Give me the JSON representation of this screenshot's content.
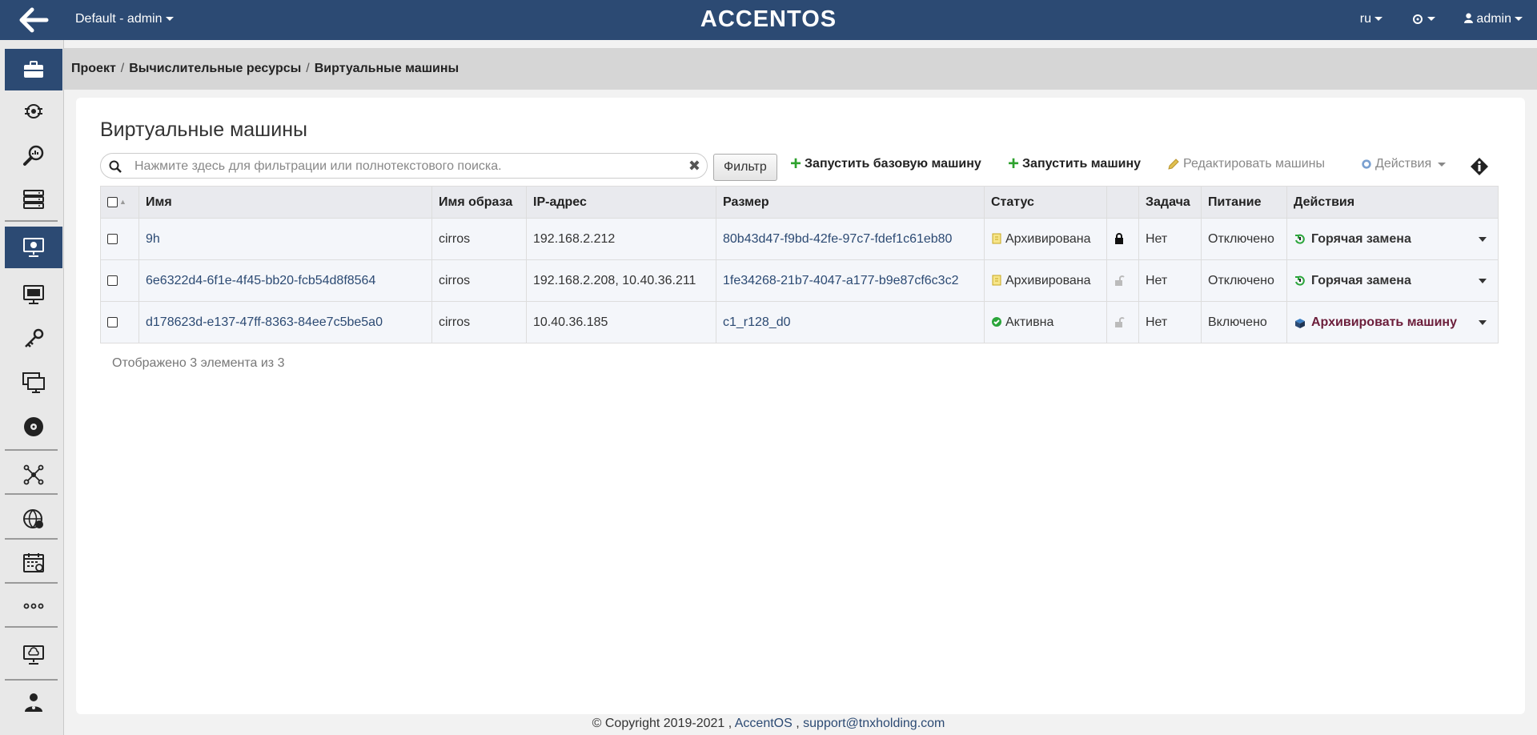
{
  "topbar": {
    "project_selector": "Default - admin",
    "logo": "ACCENTOS",
    "language": "ru",
    "user": "admin"
  },
  "sidebar": {
    "items": [
      {
        "icon": "briefcase-icon",
        "active": false
      },
      {
        "icon": "rocket-icon",
        "active": false
      },
      {
        "icon": "zoom-icon",
        "active": false
      },
      {
        "icon": "server-rack-icon",
        "active": false
      },
      {
        "icon": "monitor-cloud-icon",
        "active": true
      },
      {
        "icon": "monitor-icon",
        "active": false
      },
      {
        "icon": "key-icon",
        "active": false
      },
      {
        "icon": "multi-monitor-icon",
        "active": false
      },
      {
        "icon": "disk-icon",
        "active": false
      },
      {
        "icon": "network-icon",
        "active": false
      },
      {
        "icon": "globe-gear-icon",
        "active": false
      },
      {
        "icon": "calendar-icon",
        "active": false
      },
      {
        "icon": "more-icon",
        "active": false
      },
      {
        "icon": "cloud-monitor-icon",
        "active": false
      },
      {
        "icon": "users-icon",
        "active": false
      }
    ]
  },
  "breadcrumb": {
    "items": [
      "Проект",
      "Вычислительные ресурсы",
      "Виртуальные машины"
    ]
  },
  "page": {
    "title": "Виртуальные машины"
  },
  "search": {
    "placeholder": "Нажмите здесь для фильтрации или полнотекстового поиска."
  },
  "toolbar": {
    "filter": "Фильтр",
    "launch_base": "Запустить базовую машину",
    "launch": "Запустить машину",
    "edit": "Редактировать машины",
    "actions": "Действия"
  },
  "table": {
    "headers": [
      "Имя",
      "Имя образа",
      "IP-адрес",
      "Размер",
      "Статус",
      "",
      "Задача",
      "Питание",
      "Действия"
    ],
    "rows": [
      {
        "name": "9h",
        "image": "cirros",
        "ip": "192.168.2.212",
        "size": "80b43d47-f9bd-42fe-97c7-fdef1c61eb80",
        "status": "Архивирована",
        "status_icon": "archive-status-icon",
        "locked": true,
        "task": "Нет",
        "power": "Отключено",
        "action": "Горячая замена",
        "action_icon": "hot-swap-icon"
      },
      {
        "name": "6e6322d4-6f1e-4f45-bb20-fcb54d8f8564",
        "image": "cirros",
        "ip": "192.168.2.208, 10.40.36.211",
        "size": "1fe34268-21b7-4047-a177-b9e87cf6c3c2",
        "status": "Архивирована",
        "status_icon": "archive-status-icon",
        "locked": false,
        "task": "Нет",
        "power": "Отключено",
        "action": "Горячая замена",
        "action_icon": "hot-swap-icon"
      },
      {
        "name": "d178623d-e137-47ff-8363-84ee7c5be5a0",
        "image": "cirros",
        "ip": "10.40.36.185",
        "size": "c1_r128_d0",
        "status": "Активна",
        "status_icon": "active-status-icon",
        "locked": false,
        "task": "Нет",
        "power": "Включено",
        "action": "Архивировать машину",
        "action_icon": "archive-box-icon"
      }
    ]
  },
  "count_text": "Отображено 3 элемента из 3",
  "footer": {
    "copyright": "© Copyright 2019-2021 ,",
    "brand": "AccentOS",
    "comma": ",",
    "email": "support@tnxholding.com"
  },
  "colors": {
    "topbar": "#2c4a73",
    "plus": "#2ea22e",
    "active": "#2aa53a",
    "archive_action": "#6b1d3a"
  }
}
